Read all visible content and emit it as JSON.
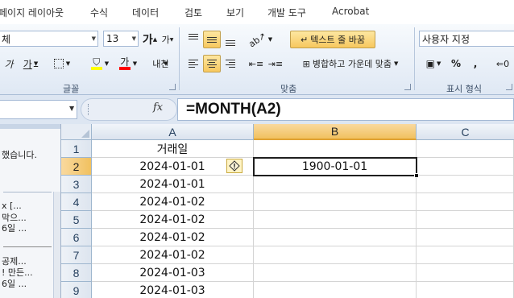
{
  "tabs": [
    "페이지 레이아웃",
    "수식",
    "데이터",
    "검토",
    "보기",
    "개발 도구",
    "Acrobat"
  ],
  "ribbon": {
    "font_name": "체",
    "font_size": "13",
    "wrap_text": "텍스트 줄 바꿈",
    "merge_center": "병합하고 가운데 맞춤",
    "number_format": "사용자 지정",
    "italic": "가",
    "underline": "가",
    "font_color": "가",
    "phonetic": "내천",
    "grow_font": "가",
    "shrink_font": "가",
    "percent": "%",
    "comma": ",",
    "groups": {
      "font": "글꼴",
      "alignment": "맞춤",
      "number": "표시 형식"
    },
    "colors": {
      "highlight": "#ffff00",
      "font_color": "#ff0000"
    }
  },
  "formula_bar": {
    "name_box": "",
    "fx_label": "fx",
    "formula": "=MONTH(A2)"
  },
  "task_pane": {
    "line1": "했습니다.",
    "item1_a": "x [...",
    "item1_b": "막으...",
    "item1_c": "6일 ...",
    "item2_a": "공제...",
    "item2_b": "! 만든...",
    "item2_c": "6일 ..."
  },
  "grid": {
    "columns": [
      "A",
      "B",
      "C"
    ],
    "selected_column": "B",
    "selected_row": "2",
    "rows": [
      {
        "num": "1",
        "a": "거래일",
        "b": ""
      },
      {
        "num": "2",
        "a": "2024-01-01",
        "b": "1900-01-01"
      },
      {
        "num": "3",
        "a": "2024-01-01",
        "b": ""
      },
      {
        "num": "4",
        "a": "2024-01-02",
        "b": ""
      },
      {
        "num": "5",
        "a": "2024-01-02",
        "b": ""
      },
      {
        "num": "6",
        "a": "2024-01-02",
        "b": ""
      },
      {
        "num": "7",
        "a": "2024-01-02",
        "b": ""
      },
      {
        "num": "8",
        "a": "2024-01-03",
        "b": ""
      },
      {
        "num": "9",
        "a": "2024-01-03",
        "b": ""
      }
    ]
  }
}
